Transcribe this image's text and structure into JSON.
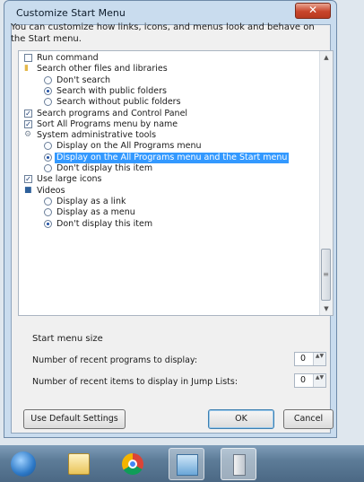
{
  "dialog": {
    "title": "Customize Start Menu",
    "close_glyph": "✕",
    "description": "You can customize how links, icons, and menus look and behave on the Start menu."
  },
  "options": [
    {
      "kind": "checkbox",
      "indent": 0,
      "label": "Run command",
      "checked": false
    },
    {
      "kind": "folder",
      "indent": 0,
      "label": "Search other files and libraries",
      "icon": "folder-icon"
    },
    {
      "kind": "radio",
      "indent": 1,
      "label": "Don't search",
      "checked": false
    },
    {
      "kind": "radio",
      "indent": 1,
      "label": "Search with public folders",
      "checked": true
    },
    {
      "kind": "radio",
      "indent": 1,
      "label": "Search without public folders",
      "checked": false
    },
    {
      "kind": "checkbox",
      "indent": 0,
      "label": "Search programs and Control Panel",
      "checked": true
    },
    {
      "kind": "checkbox",
      "indent": 0,
      "label": "Sort All Programs menu by name",
      "checked": true
    },
    {
      "kind": "folder",
      "indent": 0,
      "label": "System administrative tools",
      "icon": "admin-tools-icon"
    },
    {
      "kind": "radio",
      "indent": 1,
      "label": "Display on the All Programs menu",
      "checked": false
    },
    {
      "kind": "radio",
      "indent": 1,
      "label": "Display on the All Programs menu and the Start menu",
      "checked": true,
      "selected": true
    },
    {
      "kind": "radio",
      "indent": 1,
      "label": "Don't display this item",
      "checked": false
    },
    {
      "kind": "checkbox",
      "indent": 0,
      "label": "Use large icons",
      "checked": true
    },
    {
      "kind": "folder",
      "indent": 0,
      "label": "Videos",
      "icon": "videos-icon"
    },
    {
      "kind": "radio",
      "indent": 1,
      "label": "Display as a link",
      "checked": false
    },
    {
      "kind": "radio",
      "indent": 1,
      "label": "Display as a menu",
      "checked": false
    },
    {
      "kind": "radio",
      "indent": 1,
      "label": "Don't display this item",
      "checked": true
    }
  ],
  "scroll": {
    "up": "▲",
    "down": "▼",
    "grip": "≡"
  },
  "size_section": {
    "heading": "Start menu size",
    "recent_programs_label": "Number of recent programs to display:",
    "recent_programs_value": "0",
    "jump_list_label": "Number of recent items to display in Jump Lists:",
    "jump_list_value": "0",
    "spin_glyph": "▲▼"
  },
  "buttons": {
    "defaults": "Use Default Settings",
    "ok": "OK",
    "cancel": "Cancel"
  },
  "taskbar": {
    "items": [
      "start-orb",
      "windows-explorer",
      "google-chrome",
      "control-panel",
      "computer"
    ]
  }
}
